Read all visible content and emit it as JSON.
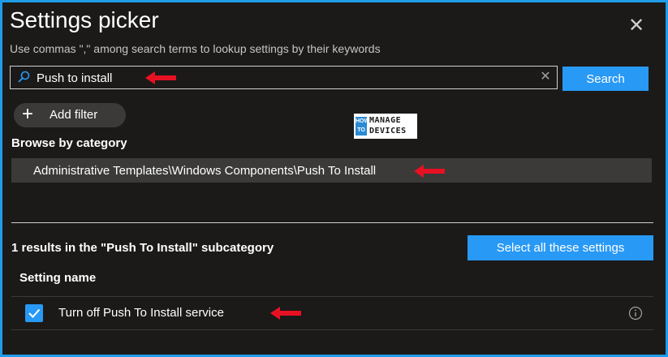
{
  "panel": {
    "title": "Settings picker",
    "close_icon": "close-icon",
    "subtitle": "Use commas \",\" among search terms to lookup settings by their keywords"
  },
  "search": {
    "value": "Push to install",
    "placeholder": "",
    "search_icon": "search-icon",
    "clear_icon": "clear-icon",
    "button_label": "Search"
  },
  "filter": {
    "add_label": "Add filter",
    "add_icon": "plus-icon"
  },
  "watermark": {
    "howto": "HOW TO",
    "brand_line1": "MANAGE",
    "brand_line2": "DEVICES"
  },
  "browse": {
    "label": "Browse by category",
    "selected_category": "Administrative Templates\\Windows Components\\Push To Install"
  },
  "results": {
    "summary": "1 results in the \"Push To Install\" subcategory",
    "select_all_label": "Select all these settings",
    "column_header": "Setting name",
    "rows": [
      {
        "name": "Turn off Push To Install service",
        "checked": true,
        "info_icon": "info-icon"
      }
    ]
  },
  "annotations": {
    "arrow_color": "#e81123"
  },
  "colors": {
    "accent": "#2899f5",
    "border": "#1e9be9",
    "background": "#1b1a19"
  }
}
